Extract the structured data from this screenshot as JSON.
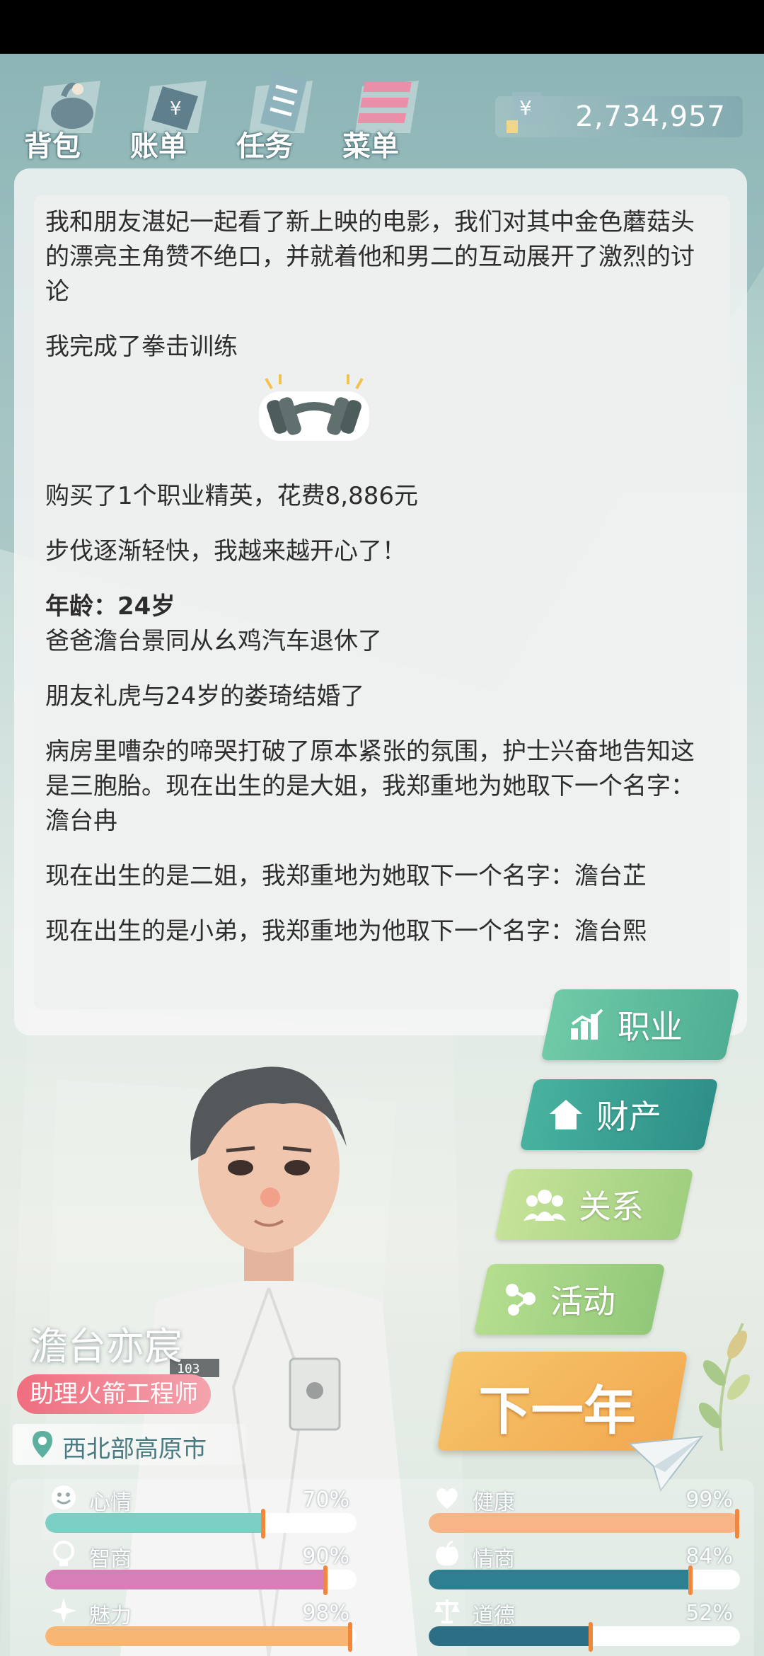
{
  "nav": {
    "items": [
      {
        "label": "背包",
        "icon": "backpack-icon"
      },
      {
        "label": "账单",
        "icon": "bill-icon"
      },
      {
        "label": "任务",
        "icon": "task-icon"
      },
      {
        "label": "菜单",
        "icon": "menu-icon"
      }
    ]
  },
  "money": {
    "symbol": "¥",
    "amount": "2,734,957"
  },
  "log": {
    "line1": "我和朋友湛妃一起看了新上映的电影，我们对其中金色蘑菇头的漂亮主角赞不绝口，并就着他和男二的互动展开了激烈的讨论",
    "line2": "我完成了拳击训练",
    "line3": "购买了1个职业精英，花费8,886元",
    "line4": "步伐逐渐轻快，我越来越开心了！",
    "age": "年龄：24岁",
    "line5": "爸爸澹台景同从幺鸡汽车退休了",
    "line6": "朋友礼虎与24岁的娄琦结婚了",
    "line7": "病房里嘈杂的啼哭打破了原本紧张的氛围，护士兴奋地告知这是三胞胎。现在出生的是大姐，我郑重地为她取下一个名字：澹台冉",
    "line8": "现在出生的是二姐，我郑重地为她取下一个名字：澹台芷",
    "line9": "现在出生的是小弟，我郑重地为他取下一个名字：澹台熙"
  },
  "actions": {
    "career": "职业",
    "property": "财产",
    "relations": "关系",
    "activity": "活动",
    "next_year": "下一年"
  },
  "character": {
    "name": "澹台亦宸",
    "job": "助理火箭工程师",
    "city": "西北部高原市"
  },
  "stats": {
    "mood": {
      "name": "心情",
      "value": "70%",
      "fraction": 0.7
    },
    "health": {
      "name": "健康",
      "value": "99%",
      "fraction": 0.99
    },
    "iq": {
      "name": "智商",
      "value": "90%",
      "fraction": 0.9
    },
    "eq": {
      "name": "情商",
      "value": "84%",
      "fraction": 0.84
    },
    "charm": {
      "name": "魅力",
      "value": "98%",
      "fraction": 0.98
    },
    "morality": {
      "name": "道德",
      "value": "52%",
      "fraction": 0.52
    }
  },
  "colors": {
    "mood": "#7ccfc4",
    "health": "#f6b487",
    "iq": "#d77db8",
    "eq": "#2e7f8f",
    "charm": "#f7b673",
    "morality": "#2c6f85",
    "career_btn": "#5fbf9c",
    "property_btn": "#3fa89a",
    "relations_btn": "#b9dc8c",
    "activity_btn": "#a8d57f"
  }
}
